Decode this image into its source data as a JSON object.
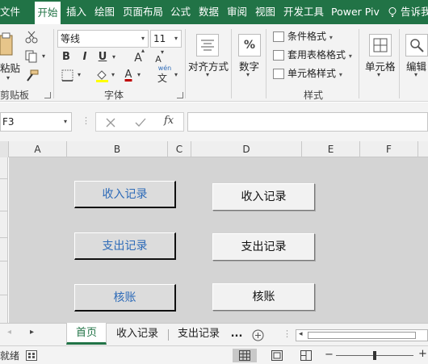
{
  "ribbon_tabs": [
    {
      "label": "文件"
    },
    {
      "label": "开始",
      "active": true
    },
    {
      "label": "插入"
    },
    {
      "label": "绘图"
    },
    {
      "label": "页面布局"
    },
    {
      "label": "公式"
    },
    {
      "label": "数据"
    },
    {
      "label": "审阅"
    },
    {
      "label": "视图"
    },
    {
      "label": "开发工具"
    },
    {
      "label": "Power Piv"
    }
  ],
  "tell_me": "告诉我",
  "clipboard": {
    "paste": "粘贴",
    "label": "剪贴板"
  },
  "font": {
    "name": "等线",
    "size": "11",
    "bold": "B",
    "italic": "I",
    "underline": "U",
    "grow": "A",
    "shrink": "A",
    "wen": "wén",
    "wen_char": "文",
    "color_a": "A",
    "label": "字体"
  },
  "alignment": {
    "label": "对齐方式"
  },
  "number": {
    "symbol": "%",
    "label": "数字"
  },
  "styles": {
    "conditional": "条件格式",
    "table": "套用表格格式",
    "cell": "单元格样式",
    "label": "样式"
  },
  "cells": {
    "label": "单元格"
  },
  "editing": {
    "label": "编辑"
  },
  "formula_bar": {
    "name_box": "F3",
    "fx": "fx",
    "value": ""
  },
  "columns": [
    "A",
    "B",
    "C",
    "D",
    "E",
    "F"
  ],
  "left_buttons": [
    "收入记录",
    "支出记录",
    "核账"
  ],
  "right_buttons": [
    "收入记录",
    "支出记录",
    "核账"
  ],
  "sheet_tabs": [
    {
      "label": "首页",
      "active": true
    },
    {
      "label": "收入记录"
    },
    {
      "label": "支出记录"
    }
  ],
  "more_sheets": "...",
  "status": {
    "ready": "就绪"
  },
  "colors": {
    "accent": "#217346",
    "link_blue": "#2e6bb8",
    "sheet_bg": "#d4d4d4"
  }
}
